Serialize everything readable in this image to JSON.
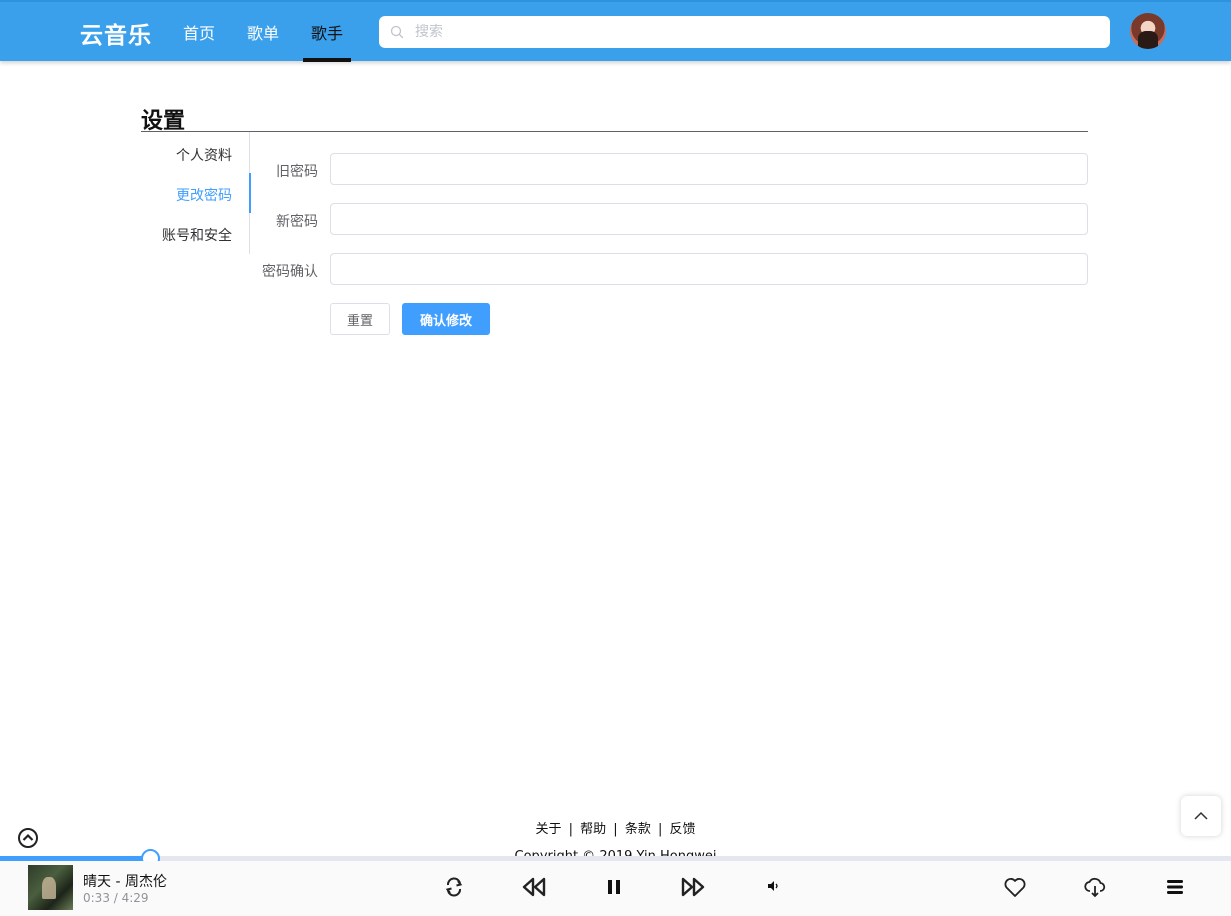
{
  "nav": {
    "logo": "云音乐",
    "items": [
      {
        "label": "首页"
      },
      {
        "label": "歌单"
      },
      {
        "label": "歌手",
        "active": true
      }
    ],
    "search_placeholder": "搜索",
    "accent_color": "#3aa0ec"
  },
  "settings": {
    "title": "设置",
    "menu": [
      {
        "label": "个人资料"
      },
      {
        "label": "更改密码",
        "active": true
      },
      {
        "label": "账号和安全"
      }
    ],
    "form": {
      "old_password_label": "旧密码",
      "new_password_label": "新密码",
      "confirm_password_label": "密码确认",
      "old_password_value": "",
      "new_password_value": "",
      "confirm_password_value": "",
      "reset_label": "重置",
      "submit_label": "确认修改"
    }
  },
  "footer": {
    "links": [
      "关于",
      "帮助",
      "条款",
      "反馈"
    ],
    "separator": "|",
    "copyright": "Copyright © 2019 Yin Hongwei"
  },
  "player": {
    "song": "晴天 - 周杰伦",
    "time": "0:33 / 4:29",
    "progress": 0.122,
    "icons": [
      "loop-icon",
      "previous-icon",
      "pause-icon",
      "next-icon",
      "volume-icon",
      "heart-icon",
      "download-icon",
      "playlist-icon"
    ],
    "primary_color": "#409eff"
  }
}
